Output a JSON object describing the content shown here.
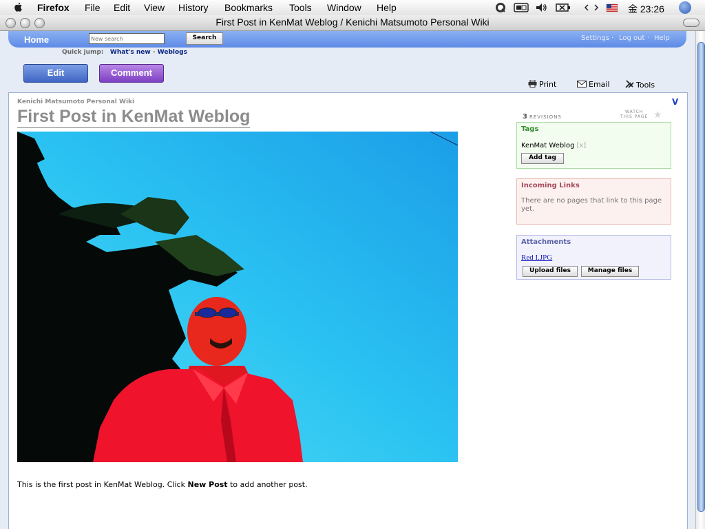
{
  "menubar": {
    "app_name": "Firefox",
    "items": [
      "File",
      "Edit",
      "View",
      "History",
      "Bookmarks",
      "Tools",
      "Window",
      "Help"
    ],
    "clock": "金 23:26"
  },
  "window": {
    "title": "First Post in KenMat Weblog / Kenichi Matsumoto Personal Wiki"
  },
  "nav": {
    "home": "Home",
    "search_placeholder": "New search",
    "search_button": "Search",
    "settings": "Settings",
    "logout": "Log out",
    "help": "Help",
    "sep": "·",
    "quick_jump_label": "Quick jump:",
    "quick_links": [
      "What's new",
      "Weblogs"
    ],
    "quick_sep": "-"
  },
  "actions": {
    "edit": "Edit",
    "comment": "Comment"
  },
  "tools": {
    "print": "Print",
    "email": "Email",
    "tools": "Tools"
  },
  "content": {
    "wiki_name": "Kenichi Matsumoto Personal Wiki",
    "page_title": "First Post in KenMat Weblog",
    "toggle": "V",
    "body_prefix": "This is the first post in KenMat Weblog. Click ",
    "body_bold": "New Post",
    "body_suffix": " to add another post."
  },
  "sidebar": {
    "revisions_count": "3",
    "revisions_label": "REVISIONS",
    "watch_line1": "WATCH",
    "watch_line2": "THIS PAGE",
    "tags": {
      "title": "Tags",
      "items": [
        "KenMat Weblog"
      ],
      "remove": "[x]",
      "add_button": "Add tag"
    },
    "incoming": {
      "title": "Incoming Links",
      "text": "There are no pages that link to this page yet."
    },
    "attachments": {
      "title": "Attachments",
      "files": [
        "Red I.JPG"
      ],
      "upload_button": "Upload files",
      "manage_button": "Manage files"
    }
  }
}
